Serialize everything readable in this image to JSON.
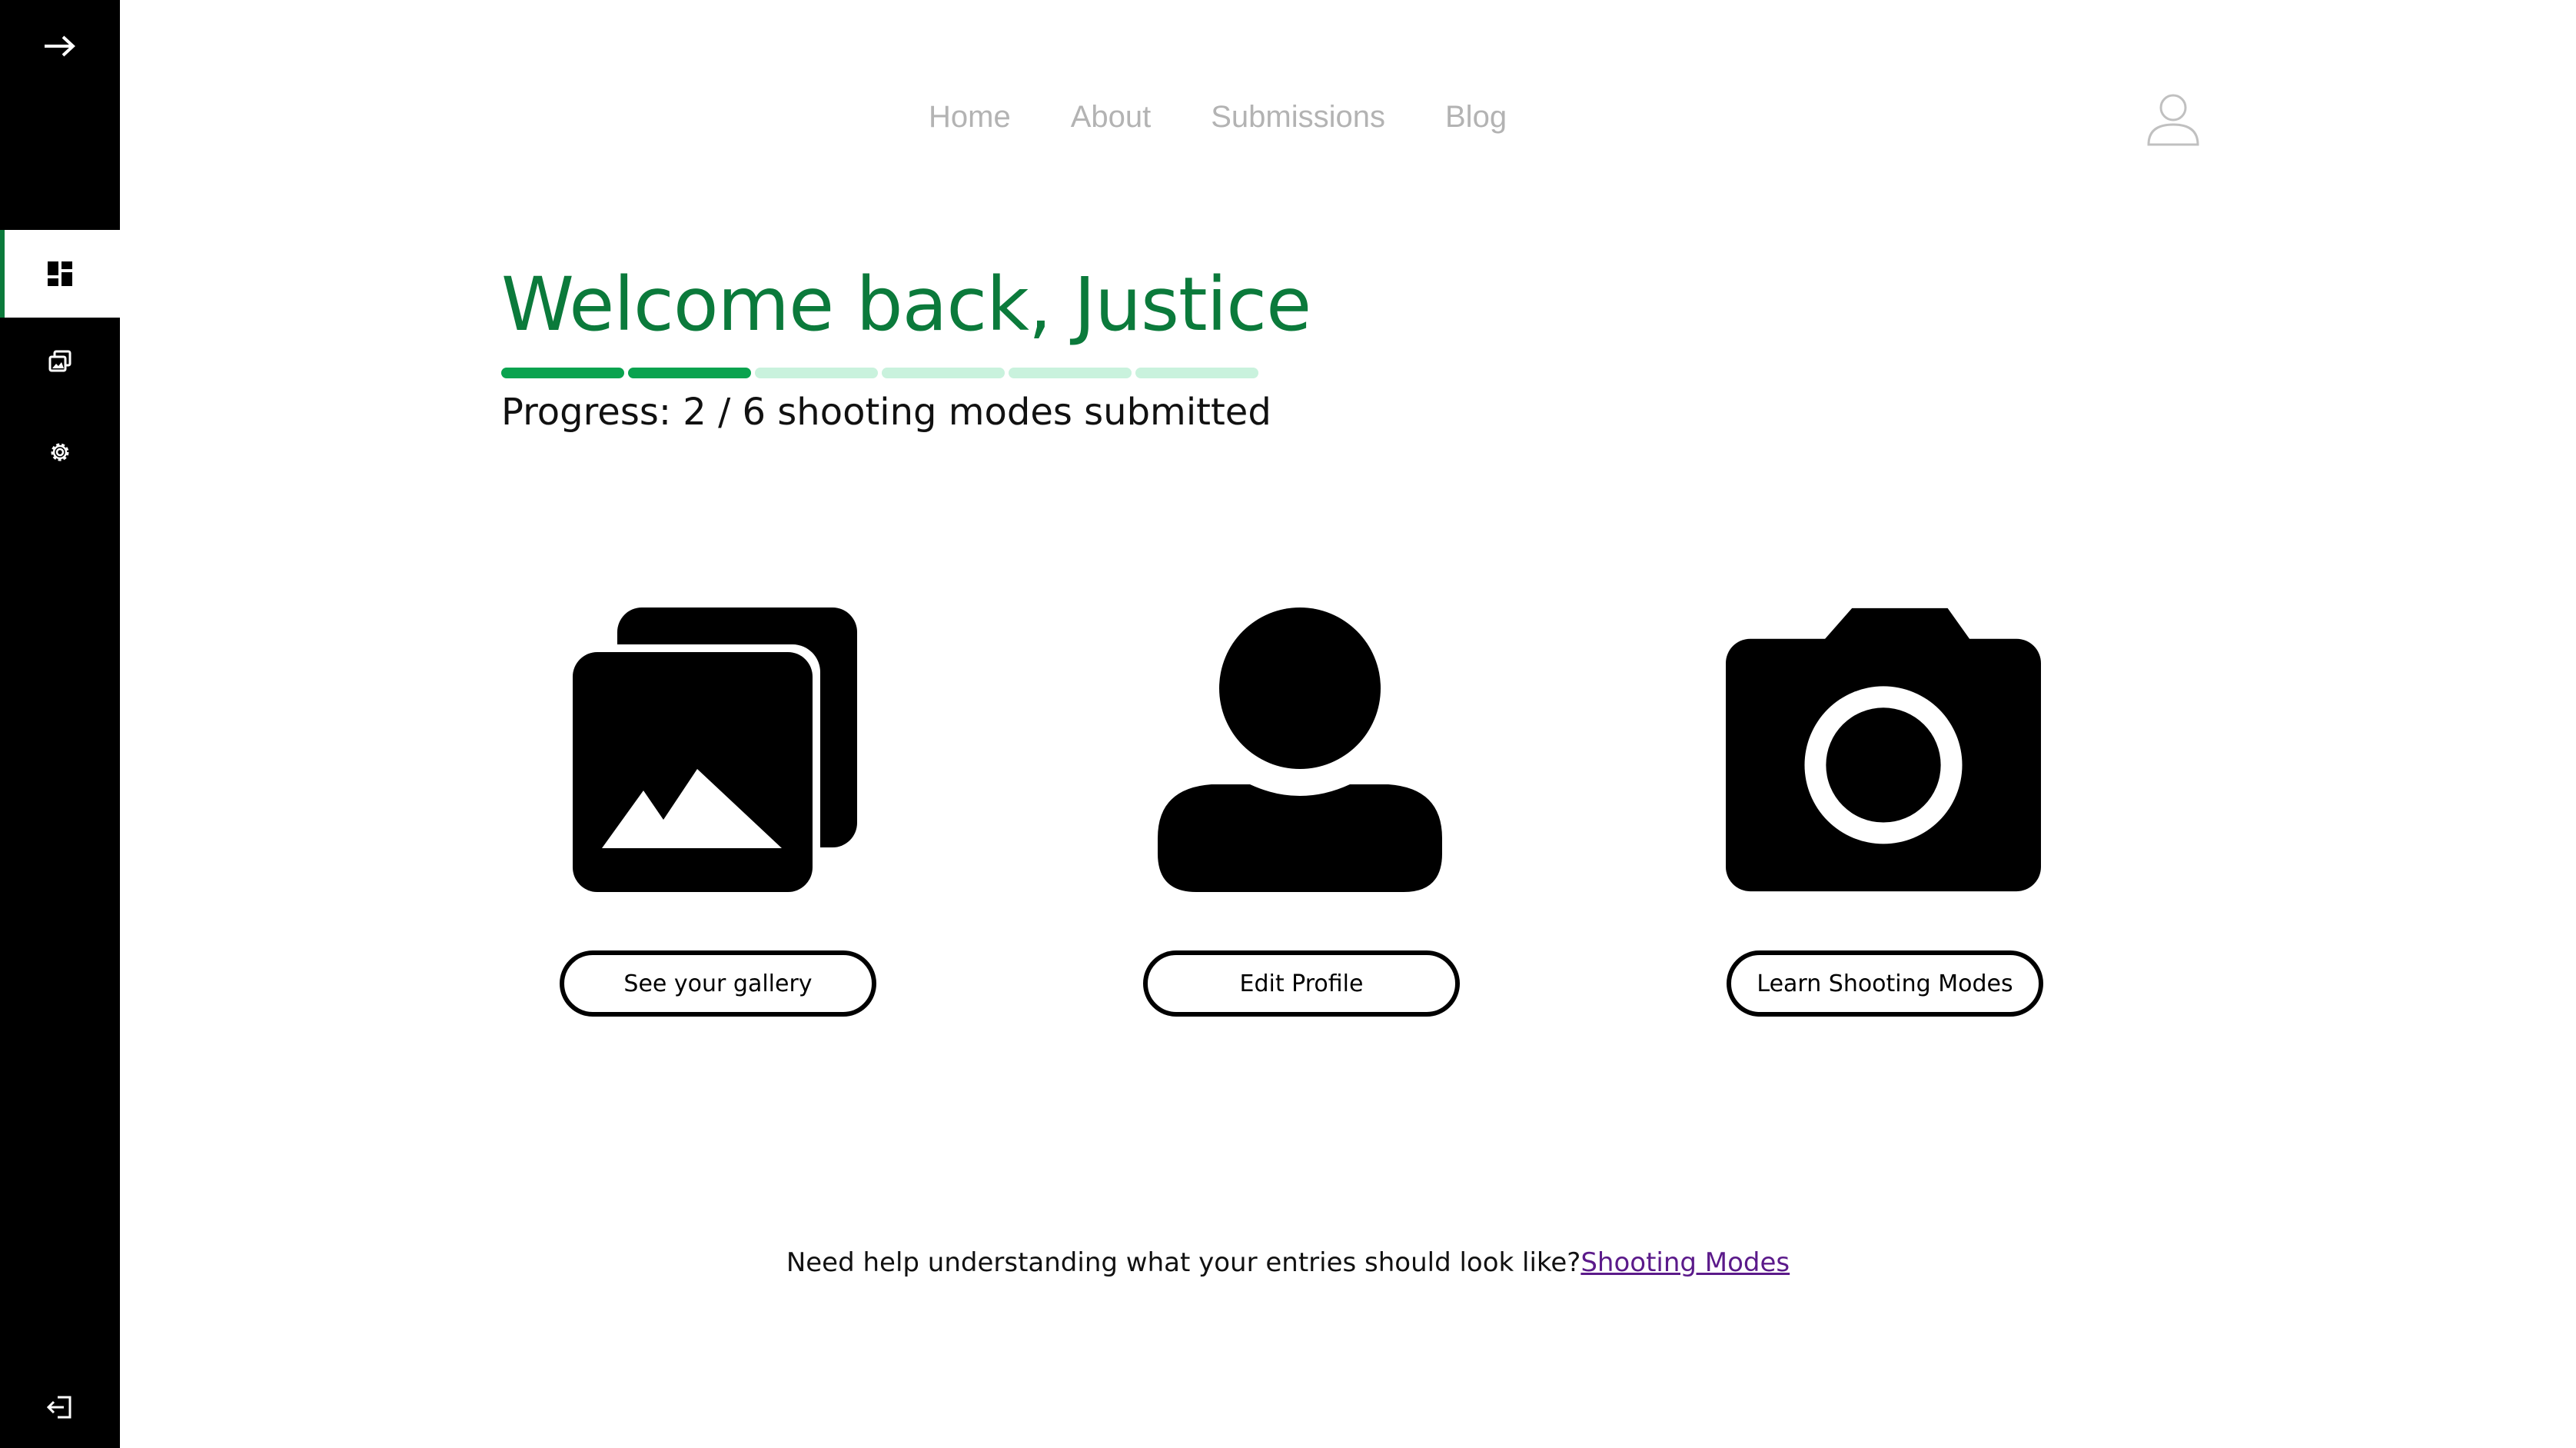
{
  "sidebar": {
    "expand_icon": "arrow-right-icon",
    "items": [
      {
        "name": "dashboard",
        "icon": "dashboard-icon",
        "active": true
      },
      {
        "name": "gallery",
        "icon": "gallery-icon",
        "active": false
      },
      {
        "name": "settings",
        "icon": "gear-icon",
        "active": false
      }
    ],
    "logout_icon": "logout-icon"
  },
  "nav": {
    "links": [
      "Home",
      "About",
      "Submissions",
      "Blog"
    ],
    "profile_icon": "user-icon"
  },
  "welcome": {
    "title": "Welcome back, Justice",
    "progress_text": "Progress: 2 / 6 shooting modes submitted",
    "progress": {
      "completed": 2,
      "total": 6
    }
  },
  "cards": [
    {
      "icon": "gallery-icon",
      "button": "See your gallery"
    },
    {
      "icon": "person-icon",
      "button": "Edit Profile"
    },
    {
      "icon": "camera-icon",
      "button": "Learn Shooting Modes"
    }
  ],
  "help": {
    "text": "Need help understanding what your entries should look like?",
    "link": "Shooting Modes"
  },
  "colors": {
    "accent": "#0b7a3b",
    "progress_done": "#0aa34f",
    "progress_todo": "#c9f2dd",
    "sidebar_bg": "#000000",
    "nav_text": "#b3b3b3",
    "link": "#5b1a8a"
  }
}
